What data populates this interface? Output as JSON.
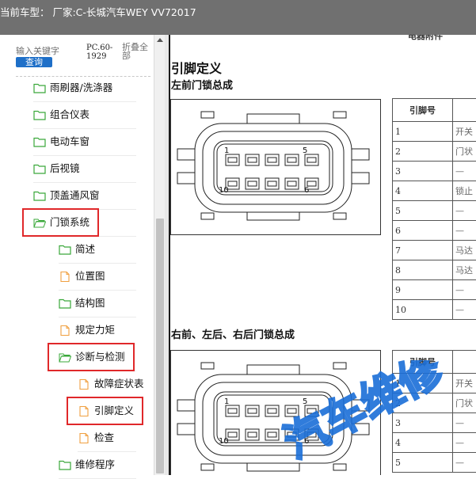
{
  "window": {
    "title": "当前车型：  厂家:C-长城汽车WEY VV72017"
  },
  "search": {
    "placeholder": "输入关键字",
    "button_label": "查询",
    "doc_code": "PC.60-1929",
    "collapse_label": "折叠全部"
  },
  "tree": [
    {
      "label": "雨刷器/洗涤器",
      "icon": "folder-icon"
    },
    {
      "label": "组合仪表",
      "icon": "folder-icon"
    },
    {
      "label": "电动车窗",
      "icon": "folder-icon"
    },
    {
      "label": "后视镜",
      "icon": "folder-icon"
    },
    {
      "label": "顶盖通风窗",
      "icon": "folder-icon"
    },
    {
      "label": "门锁系统",
      "icon": "folder-open-icon",
      "highlighted": true
    },
    {
      "label": "简述",
      "icon": "folder-icon"
    },
    {
      "label": "位置图",
      "icon": "document-icon"
    },
    {
      "label": "结构图",
      "icon": "folder-icon"
    },
    {
      "label": "规定力矩",
      "icon": "document-icon"
    },
    {
      "label": "诊断与检测",
      "icon": "folder-open-icon",
      "highlighted": true
    },
    {
      "label": "故障症状表",
      "icon": "document-icon"
    },
    {
      "label": "引脚定义",
      "icon": "document-icon",
      "highlighted": true,
      "selected": true
    },
    {
      "label": "检查",
      "icon": "document-icon"
    },
    {
      "label": "维修程序",
      "icon": "folder-icon"
    }
  ],
  "document": {
    "header_cut": "电器附件",
    "section_title": "引脚定义",
    "section1_title": "左前门锁总成",
    "section2_title": "右前、左后、右后门锁总成",
    "table_header": "引脚号",
    "connector_pin_labels": [
      "1",
      "5",
      "10",
      "6"
    ],
    "table1_rows": [
      {
        "pin": "1",
        "desc": "开关"
      },
      {
        "pin": "2",
        "desc": "门状"
      },
      {
        "pin": "3",
        "desc": "—"
      },
      {
        "pin": "4",
        "desc": "锁止"
      },
      {
        "pin": "5",
        "desc": "—"
      },
      {
        "pin": "6",
        "desc": "—"
      },
      {
        "pin": "7",
        "desc": "马达"
      },
      {
        "pin": "8",
        "desc": "马达"
      },
      {
        "pin": "9",
        "desc": "—"
      },
      {
        "pin": "10",
        "desc": "—"
      }
    ],
    "table2_rows": [
      {
        "pin": "1",
        "desc": "开关"
      },
      {
        "pin": "2",
        "desc": "门状"
      },
      {
        "pin": "3",
        "desc": "—"
      },
      {
        "pin": "4",
        "desc": "—"
      },
      {
        "pin": "5",
        "desc": "—"
      }
    ],
    "watermark": "汽车维修"
  },
  "colors": {
    "titlebar": "#707070",
    "highlight": "#e0282a",
    "folder": "#3aa83a",
    "document": "#f0a040",
    "button": "#1e6fc8",
    "watermark": "#1a6ed8"
  }
}
